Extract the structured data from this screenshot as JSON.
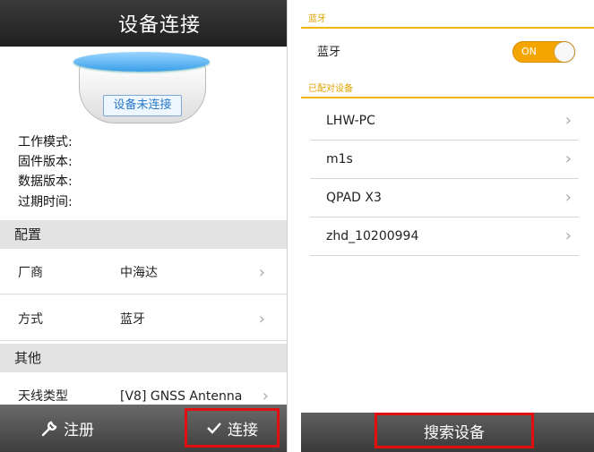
{
  "left": {
    "title": "设备连接",
    "device_status": "设备未连接",
    "info_labels": [
      "工作模式:",
      "固件版本:",
      "数据版本:",
      "过期时间:"
    ],
    "config_section": "配置",
    "rows": [
      {
        "label": "厂商",
        "value": "中海达"
      },
      {
        "label": "方式",
        "value": "蓝牙"
      }
    ],
    "other_section": "其他",
    "antenna": {
      "label": "天线类型",
      "value": "[V8] GNSS Antenna"
    },
    "register_label": "注册",
    "connect_label": "连接"
  },
  "right": {
    "bluetooth_header": "蓝牙",
    "bluetooth_label": "蓝牙",
    "toggle_label": "ON",
    "toggle_on": true,
    "paired_header": "已配对设备",
    "devices": [
      "LHW-PC",
      "m1s",
      "QPAD X3",
      "zhd_10200994"
    ],
    "search_label": "搜索设备"
  },
  "colors": {
    "highlight_border": "#e10f0f",
    "accent": "#f5a500",
    "device_label": "#2a7ac8"
  },
  "icons": [
    "wrench-icon",
    "checkmark-icon",
    "chevron-right-icon"
  ]
}
